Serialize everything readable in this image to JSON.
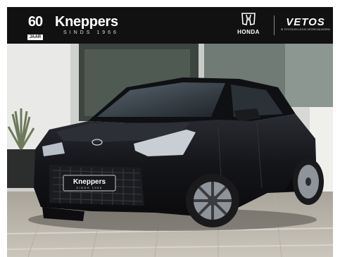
{
  "banner": {
    "anniversary_number": "60",
    "anniversary_word": "JAAR",
    "brand_name": "Kneppers",
    "brand_since": "SINDS 1966",
    "partner1_name": "HONDA",
    "partner2_name": "VETOS",
    "partner2_tagline": "IN TOYOTA EN LEXUS GESPECIALISEERD"
  },
  "plate": {
    "brand": "Kneppers",
    "since": "SINDS 1966"
  },
  "colors": {
    "banner_bg": "#111111",
    "car_body": "#16171b",
    "pavement": "#bdb8ae"
  },
  "icons": [
    "honda-h-logo-icon",
    "toyota-emblem-icon"
  ]
}
